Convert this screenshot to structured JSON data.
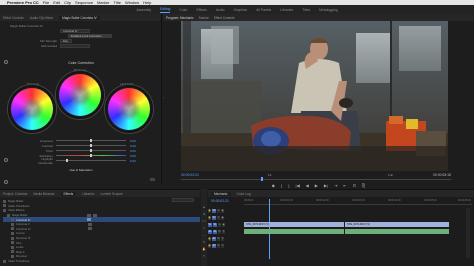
{
  "menubar": {
    "apple": "",
    "app": "Premiere Pro CC",
    "items": [
      "File",
      "Edit",
      "Clip",
      "Sequence",
      "Marker",
      "Title",
      "Window",
      "Help"
    ]
  },
  "workspaces": {
    "items": [
      "Assembly",
      "Editing",
      "Color",
      "Effects",
      "Audio",
      "Graphics",
      "All Panels",
      "Libraries",
      "Titles",
      "Metalogging",
      "Metalogging"
    ],
    "active_index": 1
  },
  "lumetri": {
    "tabs": [
      "Effect Controls",
      "Audio Clip Mixer",
      "Lumetri Scopes"
    ],
    "active_tab": "Magic Bullet Colorista IV",
    "header1": "Magic Bullet Colorista IV",
    "header2": "Magic Bullet Colorista IV",
    "dd1": "Colorista IV",
    "dd2": "Enabled Look Correction",
    "label_mix": "Mix Strength",
    "dd_mix": "Day",
    "label_edit": "Edit Guided",
    "section_color": "Color Correction",
    "wheels": [
      {
        "label": "Shadows"
      },
      {
        "label": "Midtones"
      },
      {
        "label": "Highlights"
      }
    ],
    "sliders": [
      {
        "label": "Exposure",
        "value": "0.00"
      },
      {
        "label": "Contrast",
        "value": "0.00"
      },
      {
        "label": "Pivot",
        "value": "0.00"
      },
      {
        "label": "Saturation",
        "value": "0.00"
      },
      {
        "label": "Highlight Desaturate",
        "value": "0.00"
      }
    ],
    "section_hue": "Hue & Saturation"
  },
  "program": {
    "tabs": [
      "Program: Mechanic",
      "Source",
      "Effect Controls"
    ],
    "timecode_left": "00:00:02:21",
    "fit": "Fit",
    "quality": "Full",
    "timecode_right": "00:00:08:18",
    "transport": [
      "◆",
      "{",
      "}",
      "|◀",
      "◀",
      "▶",
      "▶|",
      "⇥",
      "⇤",
      "⊡",
      "⎘"
    ]
  },
  "effects": {
    "tabs": [
      "Project: Colorista",
      "Media Browser",
      "Effects",
      "Libraries",
      "Lumetri Scopes"
    ],
    "active_tab": "Effects",
    "items": [
      "Magic Bullet",
      "Audio Transitions",
      "Video Effects",
      "Magic Bullet",
      "Colorista IV",
      "Colorista V",
      "Colorista VI",
      "Cosmo",
      "Denoiser III",
      "Film",
      "Looks",
      "Mojo II",
      "Renoiser",
      "Video Transitions"
    ]
  },
  "timeline": {
    "tabs": [
      "Mechanic",
      "Color Log"
    ],
    "timecode": "00:00:02:21",
    "ruler": [
      "00:00:00",
      "00:00:01:00",
      "00:00:02:00",
      "00:00:03:00",
      "00:00:04:00",
      "00:00:05:00",
      "00:00:06:00"
    ],
    "tracks": [
      "V3",
      "V2",
      "V1",
      "A1",
      "A2",
      "A3"
    ],
    "clips": [
      {
        "track": 2,
        "label": "STE_0073.MOV [V]"
      },
      {
        "track": 2,
        "label": "STE_0074.MOV [V]"
      },
      {
        "track": 3,
        "label": ""
      },
      {
        "track": 3,
        "label": ""
      }
    ]
  },
  "colors": {
    "accent": "#5aa0ff",
    "video_clip": "#a2b0dc",
    "audio_clip": "#6db07a"
  }
}
